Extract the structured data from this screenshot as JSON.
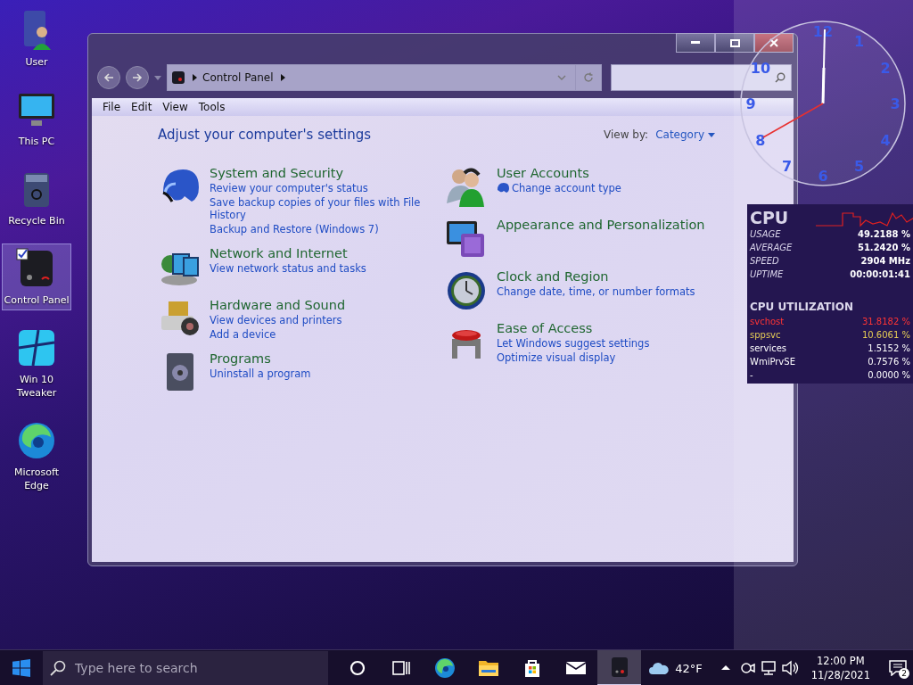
{
  "desktop_icons": [
    {
      "label": "User",
      "selected": false
    },
    {
      "label": "This PC",
      "selected": false
    },
    {
      "label": "Recycle Bin",
      "selected": false
    },
    {
      "label": "Control Panel",
      "selected": true
    },
    {
      "label": "Win 10 Tweaker",
      "selected": false
    },
    {
      "label": "Microsoft Edge",
      "selected": false
    }
  ],
  "window": {
    "address": "Control Panel",
    "menu": [
      "File",
      "Edit",
      "View",
      "Tools"
    ],
    "heading": "Adjust your computer's settings",
    "view_by_label": "View by:",
    "view_by_value": "Category",
    "left_column": [
      {
        "title": "System and Security",
        "links": [
          {
            "text": "Review your computer's status"
          },
          {
            "text": "Save backup copies of your files with File History"
          },
          {
            "text": "Backup and Restore (Windows 7)"
          }
        ]
      },
      {
        "title": "Network and Internet",
        "links": [
          {
            "text": "View network status and tasks"
          }
        ]
      },
      {
        "title": "Hardware and Sound",
        "links": [
          {
            "text": "View devices and printers"
          },
          {
            "text": "Add a device"
          }
        ]
      },
      {
        "title": "Programs",
        "links": [
          {
            "text": "Uninstall a program"
          }
        ]
      }
    ],
    "right_column": [
      {
        "title": "User Accounts",
        "links": [
          {
            "text": "Change account type",
            "shield": true
          }
        ]
      },
      {
        "title": "Appearance and Personalization"
      },
      {
        "title": "Clock and Region",
        "links": [
          {
            "text": "Change date, time, or number formats"
          }
        ]
      },
      {
        "title": "Ease of Access",
        "links": [
          {
            "text": "Let Windows suggest settings"
          },
          {
            "text": "Optimize visual display"
          }
        ]
      }
    ]
  },
  "clock": {
    "numbers": [
      "12",
      "1",
      "2",
      "3",
      "4",
      "5",
      "6",
      "7",
      "8",
      "9",
      "10"
    ]
  },
  "cpu": {
    "title": "CPU",
    "stats": [
      {
        "label": "USAGE",
        "value": "49.2188 %"
      },
      {
        "label": "AVERAGE",
        "value": "51.2420 %"
      },
      {
        "label": "SPEED",
        "value": "2904 MHz"
      },
      {
        "label": "UPTIME",
        "value": "00:00:01:41"
      }
    ],
    "section": "CPU UTILIZATION",
    "processes": [
      {
        "name": "svchost",
        "value": "31.8182 %",
        "color": "#ff3434"
      },
      {
        "name": "sppsvc",
        "value": "10.6061 %",
        "color": "#e6cc55"
      },
      {
        "name": "services",
        "value": "1.5152 %",
        "color": "#ffffff"
      },
      {
        "name": "WmiPrvSE",
        "value": "0.7576 %",
        "color": "#ffffff"
      },
      {
        "name": "-",
        "value": "0.0000 %",
        "color": "#ffffff"
      }
    ]
  },
  "taskbar": {
    "search_placeholder": "Type here to search",
    "apps": [
      {
        "selected": false
      },
      {
        "selected": false
      },
      {
        "selected": false
      },
      {
        "selected": false
      },
      {
        "selected": false
      },
      {
        "selected": false
      },
      {
        "selected": true
      }
    ],
    "weather": "42°F",
    "time": "12:00 PM",
    "date": "11/28/2021",
    "notifications": "2"
  }
}
